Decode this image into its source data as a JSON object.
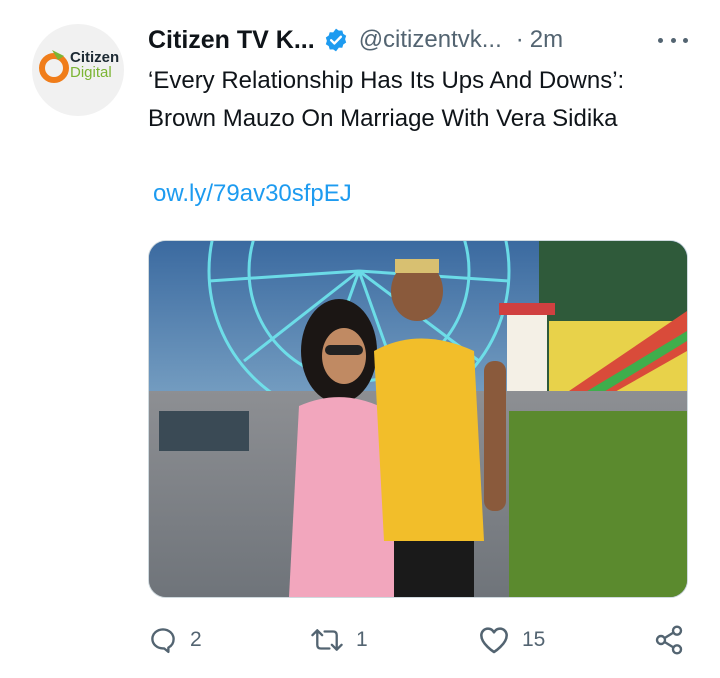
{
  "account": {
    "logo_text_1": "Citizen",
    "logo_text_2": "Digital",
    "display_name": "Citizen TV K...",
    "handle": "@citizentvk...",
    "separator": "·",
    "time": "2m",
    "verified_icon": "verified-badge-icon"
  },
  "tweet": {
    "text": "‘Every Relationship Has Its Ups And Downs’: Brown Mauzo On Marriage With Vera Sidika",
    "link": "ow.ly/79av30sfpEJ"
  },
  "media": {
    "description_icon": "photo"
  },
  "actions": {
    "reply_icon": "reply-icon",
    "reply_count": "2",
    "retweet_icon": "retweet-icon",
    "retweet_count": "1",
    "like_icon": "heart-icon",
    "like_count": "15",
    "share_icon": "share-icon"
  },
  "colors": {
    "accent": "#1d9bf0",
    "muted": "#536471",
    "brand_green": "#7cb534",
    "brand_orange": "#f07d1a"
  }
}
